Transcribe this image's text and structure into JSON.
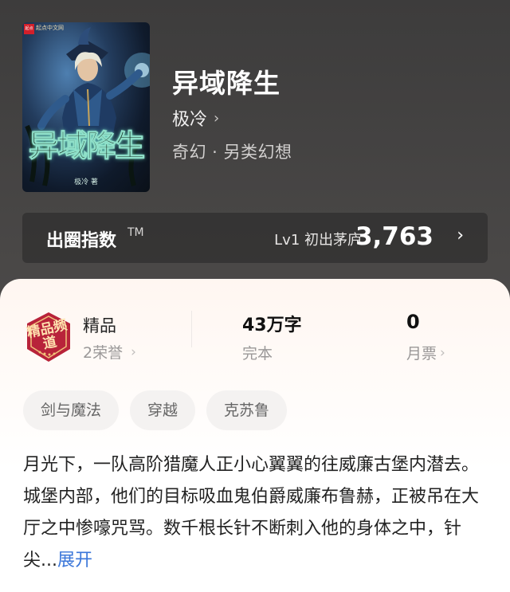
{
  "book": {
    "title": "异域降生",
    "author": "极冷",
    "genre": "奇幻 · 另类幻想",
    "cover": {
      "publisher_badge": "起点",
      "publisher_text": "起点中文网",
      "title": "异域降生",
      "author_line": "极冷 著"
    }
  },
  "index": {
    "label": "出圈指数",
    "tm": "TM",
    "level": "Lv1 初出茅庐",
    "value": "3,763"
  },
  "stats": {
    "quality_badge": "精品频道",
    "quality_label": "精品",
    "honor": "2荣誉",
    "words": "43万字",
    "words_label": "完本",
    "monthly_ticket": "0",
    "monthly_ticket_label": "月票"
  },
  "tags": [
    "剑与魔法",
    "穿越",
    "克苏鲁"
  ],
  "summary": {
    "text": "月光下，一队高阶猎魔人正小心翼翼的往威廉古堡内潜去。城堡内部，他们的目标吸血鬼伯爵威廉布鲁赫，正被吊在大厅之中惨嚎咒骂。数千根长针不断刺入他的身体之中，针尖...",
    "expand": "展开"
  },
  "colors": {
    "accent_link": "#3a76d9",
    "badge_red": "#b8233a",
    "header_bg": "#484645"
  }
}
